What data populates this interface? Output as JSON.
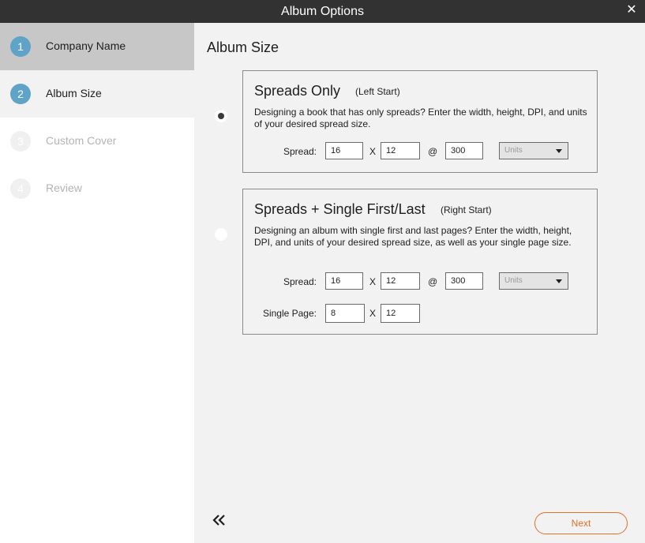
{
  "window": {
    "title": "Album Options",
    "close_icon": "close-icon"
  },
  "steps": [
    {
      "num": "1",
      "label": "Company Name",
      "state": "completed"
    },
    {
      "num": "2",
      "label": "Album Size",
      "state": "current"
    },
    {
      "num": "3",
      "label": "Custom Cover",
      "state": "future"
    },
    {
      "num": "4",
      "label": "Review",
      "state": "future"
    }
  ],
  "main": {
    "title": "Album Size"
  },
  "options": [
    {
      "heading": "Spreads Only",
      "sub": "(Left Start)",
      "selected": true,
      "description": "Designing a book that has only spreads? Enter the width, height, DPI, and units of your desired spread size.",
      "spread_label": "Spread:",
      "spread_width": "16",
      "x_sep": "X",
      "spread_height": "12",
      "at_sep": "@",
      "dpi": "300",
      "units_placeholder": "Units"
    },
    {
      "heading": "Spreads + Single First/Last",
      "sub": "(Right Start)",
      "selected": false,
      "description": "Designing an album with single first and last pages? Enter the width, height, DPI, and units of your desired spread size, as well as your single page size.",
      "spread_label": "Spread:",
      "spread_width": "16",
      "x_sep": "X",
      "spread_height": "12",
      "at_sep": "@",
      "dpi": "300",
      "units_placeholder": "Units",
      "single_label": "Single Page:",
      "single_width": "8",
      "single_height": "12"
    }
  ],
  "footer": {
    "back_icon": "double-chevron-left-icon",
    "next_label": "Next"
  },
  "colors": {
    "accent": "#e0702a",
    "step_circle": "#5fa3c8",
    "titlebar": "#323232"
  }
}
